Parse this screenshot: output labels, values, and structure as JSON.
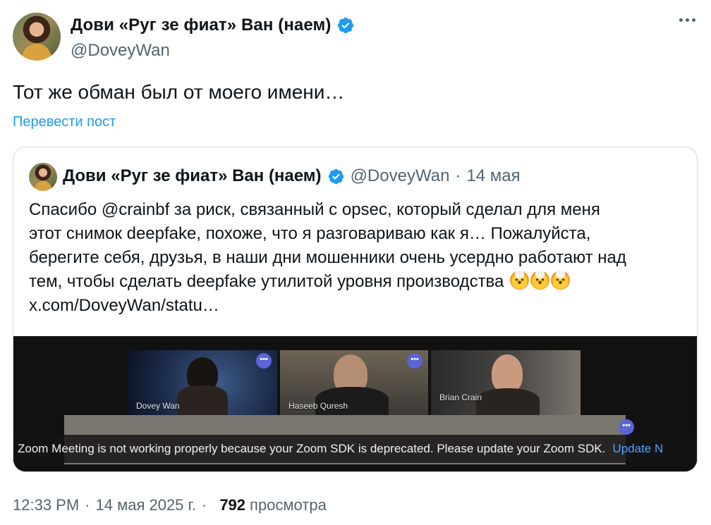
{
  "author": {
    "display_name": "Дови «Руг зе фиат» Ван (наем)",
    "handle": "@DoveyWan"
  },
  "tweet": {
    "text": "Тот же обман был от моего имени…",
    "translate_label": "Перевести пост"
  },
  "quoted": {
    "display_name": "Дови «Руг зе фиат» Ван (наем)",
    "handle": "@DoveyWan",
    "dot": "·",
    "date": "14 мая",
    "lines": [
      "Спасибо  @crainbf  за риск, связанный с opsec, который сделал для меня",
      "этот снимок deepfake, похоже, что я разговариваю как я… Пожалуйста,",
      "берегите себя, друзья, в наши дни мошенники очень усердно работают над",
      "тем, чтобы сделать deepfake утилитой уровня производства",
      "x.com/DoveyWan/statu…"
    ],
    "media": {
      "participants": [
        "Dovey Wan",
        "Haseeb Quresh",
        "Brian Crain"
      ],
      "menu_glyph": "•••",
      "notice_text": "Zoom Meeting is not working properly because your Zoom SDK is deprecated. Please update your Zoom SDK.",
      "notice_link": "Update N"
    }
  },
  "meta": {
    "time": "12:33 PM",
    "dot1": "·",
    "date": "14 мая 2025 г.",
    "dot2": "·",
    "views_count": "792",
    "views_label": "просмотра"
  },
  "colors": {
    "accent": "#1d9bf0",
    "secondary_text": "#536471",
    "border": "#cfd9de"
  }
}
